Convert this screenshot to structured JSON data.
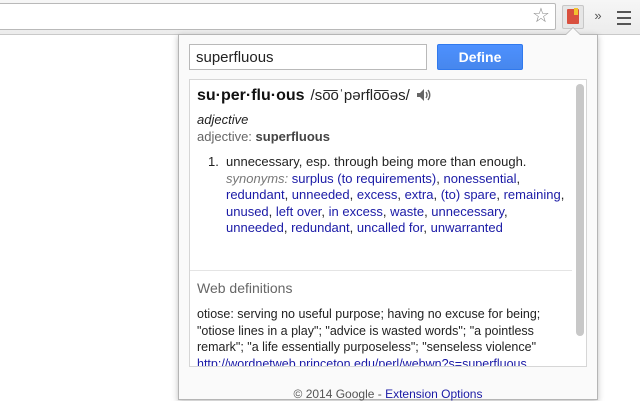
{
  "browser": {
    "star_icon": "star-icon",
    "extension_icon": "dictionary-extension-icon",
    "overflow_icon": "chevron-right-icon",
    "menu_icon": "hamburger-menu-icon"
  },
  "popup": {
    "search": {
      "value": "superfluous",
      "placeholder": ""
    },
    "define_label": "Define",
    "entry": {
      "headword": "su·per·flu·ous",
      "pronunciation": "/so͞oˈpərflo͞oəs/",
      "speaker_icon": "speaker-icon",
      "part_of_speech": "adjective",
      "pos_prefix": "adjective: ",
      "pos_word": "superfluous",
      "sense": {
        "number": "1.",
        "definition": "unnecessary, esp. through being more than enough.",
        "synonyms_label": "synonyms:",
        "synonyms": [
          "surplus (to requirements)",
          "nonessential",
          "redundant",
          "unneeded",
          "excess",
          "extra",
          "(to) spare",
          "remaining",
          "unused",
          "left over",
          "in excess",
          "waste",
          "unnecessary",
          "unneeded",
          "redundant",
          "uncalled for",
          "unwarranted"
        ]
      }
    },
    "web_definitions": {
      "title": "Web definitions",
      "text": "otiose: serving no useful purpose; having no excuse for being; \"otiose lines in a play\"; \"advice is wasted words\"; \"a pointless remark\"; \"a life essentially purposeless\"; \"senseless violence\"",
      "link": "http://wordnetweb.princeton.edu/perl/webwn?s=superfluous"
    },
    "footer": {
      "copyright": "© 2014 Google - ",
      "options_link": "Extension Options"
    }
  },
  "colors": {
    "accent_button": "#4d90fe",
    "link": "#1a1aa6"
  }
}
